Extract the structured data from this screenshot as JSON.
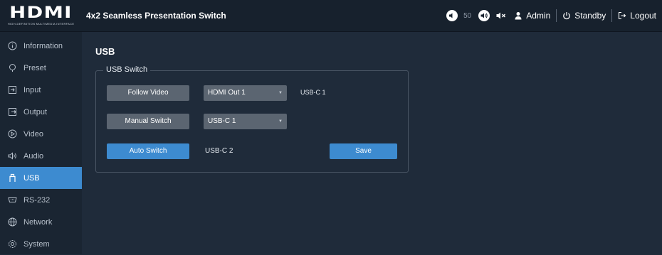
{
  "header": {
    "logo_text": "HDMI",
    "logo_tagline": "HIGH-DEFINITION MULTIMEDIA INTERFACE",
    "title": "4x2 Seamless Presentation Switch",
    "volume_value": "50",
    "user_label": "Admin",
    "standby_label": "Standby",
    "logout_label": "Logout"
  },
  "sidebar": {
    "items": [
      {
        "label": "Information",
        "icon": "info-icon"
      },
      {
        "label": "Preset",
        "icon": "preset-icon"
      },
      {
        "label": "Input",
        "icon": "input-icon"
      },
      {
        "label": "Output",
        "icon": "output-icon"
      },
      {
        "label": "Video",
        "icon": "video-icon"
      },
      {
        "label": "Audio",
        "icon": "audio-icon"
      },
      {
        "label": "USB",
        "icon": "usb-icon",
        "active": true
      },
      {
        "label": "RS-232",
        "icon": "rs232-icon"
      },
      {
        "label": "Network",
        "icon": "network-icon"
      },
      {
        "label": "System",
        "icon": "system-icon"
      }
    ]
  },
  "main": {
    "page_title": "USB",
    "usb_switch": {
      "legend": "USB Switch",
      "follow_video_label": "Follow Video",
      "follow_video_select": "HDMI Out 1",
      "follow_video_status": "USB-C 1",
      "manual_switch_label": "Manual Switch",
      "manual_switch_select": "USB-C 1",
      "auto_switch_label": "Auto Switch",
      "auto_switch_status": "USB-C 2",
      "save_label": "Save"
    }
  },
  "colors": {
    "accent": "#3d8bd0",
    "background": "#1f2b3a",
    "sidebar": "#1a2532",
    "header": "#17212d",
    "control_gray": "#5b6571"
  }
}
